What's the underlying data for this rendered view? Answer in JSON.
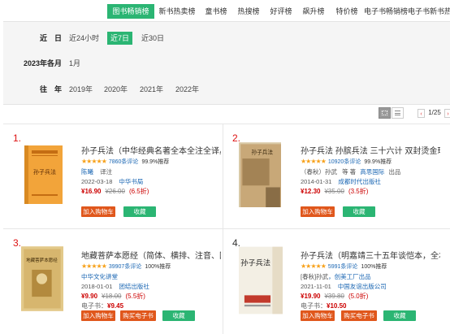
{
  "tabs": [
    "图书畅销榜",
    "新书热卖榜",
    "童书榜",
    "热搜榜",
    "好评榜",
    "飙升榜",
    "特价榜",
    "电子书畅销榜",
    "电子书新书热卖榜"
  ],
  "filters": {
    "recent": {
      "label": "近　日",
      "options": [
        "近24小时",
        "近7日",
        "近30日"
      ]
    },
    "month": {
      "label": "2023年各月",
      "options": [
        "1月"
      ]
    },
    "year": {
      "label": "往　年",
      "options": [
        "2019年",
        "2020年",
        "2021年",
        "2022年"
      ]
    }
  },
  "pager": {
    "prev": "‹",
    "text": "1/25",
    "next": "›"
  },
  "labels": {
    "add_cart": "加入购物车",
    "favorite": "收藏",
    "buy_ebook": "购买电子书",
    "ebook_prefix": "电子书：",
    "recommend_suffix": "推荐"
  },
  "colors": {
    "accent": "#2bb573",
    "price": "#c00000",
    "rank_top": "#dd1111",
    "link": "#1a66b3",
    "star": "#f7a11a",
    "button": "#e0571c"
  },
  "products": [
    {
      "rank": "1.",
      "title": "孙子兵法（中华经典名著全本全注全译丛",
      "stars": "★★★★★",
      "comments": "7860条评论",
      "recommend": "99.9%",
      "authors": [
        "陈曦",
        "译注"
      ],
      "date": "2022-03-18",
      "publisher": "中华书局",
      "price": "¥16.90",
      "old_price": "¥26.00",
      "discount": "(6.5折)",
      "ebook_price": "",
      "cover_text": "孙子兵法"
    },
    {
      "rank": "2.",
      "title": "孙子兵法 孙膑兵法 三十六计 双封烫金珍",
      "stars": "★★★★★",
      "comments": "10920条评论",
      "recommend": "99.9%",
      "authors": [
        "（春秋）孙武",
        "等 著",
        "高思国际",
        "出品"
      ],
      "date": "2014-01-31",
      "publisher": "成都时代出版社",
      "price": "¥12.30",
      "old_price": "¥35.00",
      "discount": "(3.5折)",
      "ebook_price": "",
      "cover_text": "孙子兵法"
    },
    {
      "rank": "3.",
      "title": "地藏菩萨本愿经（简体、横排、注音、国",
      "stars": "★★★★★",
      "comments": "39907条评论",
      "recommend": "100%",
      "authors": [
        "中华文化讲堂"
      ],
      "date": "2018-01-01",
      "publisher": "团结出版社",
      "price": "¥9.90",
      "old_price": "¥18.00",
      "discount": "(5.5折)",
      "ebook_price": "¥9.45",
      "cover_text": "地藏菩萨本愿经"
    },
    {
      "rank": "4.",
      "title": "孙子兵法（明嘉靖三十五年谈恺本，全本",
      "stars": "★★★★★",
      "comments": "5991条评论",
      "recommend": "100%",
      "authors": [
        "[春秋]孙武",
        "，创美工厂出品"
      ],
      "date": "2021-11-01",
      "publisher": "中国友谊出版公司",
      "price": "¥19.90",
      "old_price": "¥39.80",
      "discount": "(5.0折)",
      "ebook_price": "¥10.50",
      "cover_text": "孙子兵法"
    }
  ]
}
